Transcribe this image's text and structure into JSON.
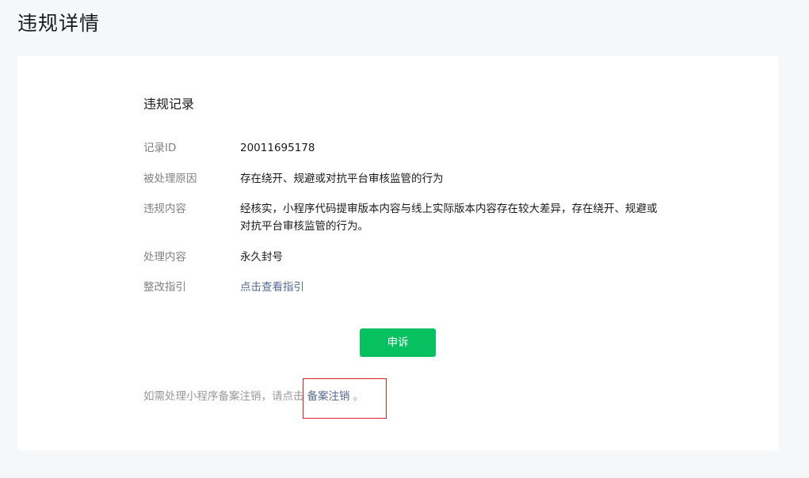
{
  "page": {
    "title": "违规详情"
  },
  "record": {
    "section_title": "违规记录",
    "rows": [
      {
        "label": "记录ID",
        "value": "20011695178"
      },
      {
        "label": "被处理原因",
        "value": "存在绕开、规避或对抗平台审核监管的行为"
      },
      {
        "label": "违规内容",
        "value": "经核实，小程序代码提审版本内容与线上实际版本内容存在较大差异，存在绕开、规避或对抗平台审核监管的行为。"
      },
      {
        "label": "处理内容",
        "value": "永久封号"
      },
      {
        "label": "整改指引",
        "value": "点击查看指引"
      }
    ]
  },
  "actions": {
    "appeal_label": "申诉"
  },
  "footer": {
    "prefix": "如需处理小程序备案注销，请点击",
    "link": "备案注销",
    "suffix": "。"
  },
  "colors": {
    "accent": "#07c160",
    "link": "#576b95",
    "annotation": "#e02020"
  }
}
